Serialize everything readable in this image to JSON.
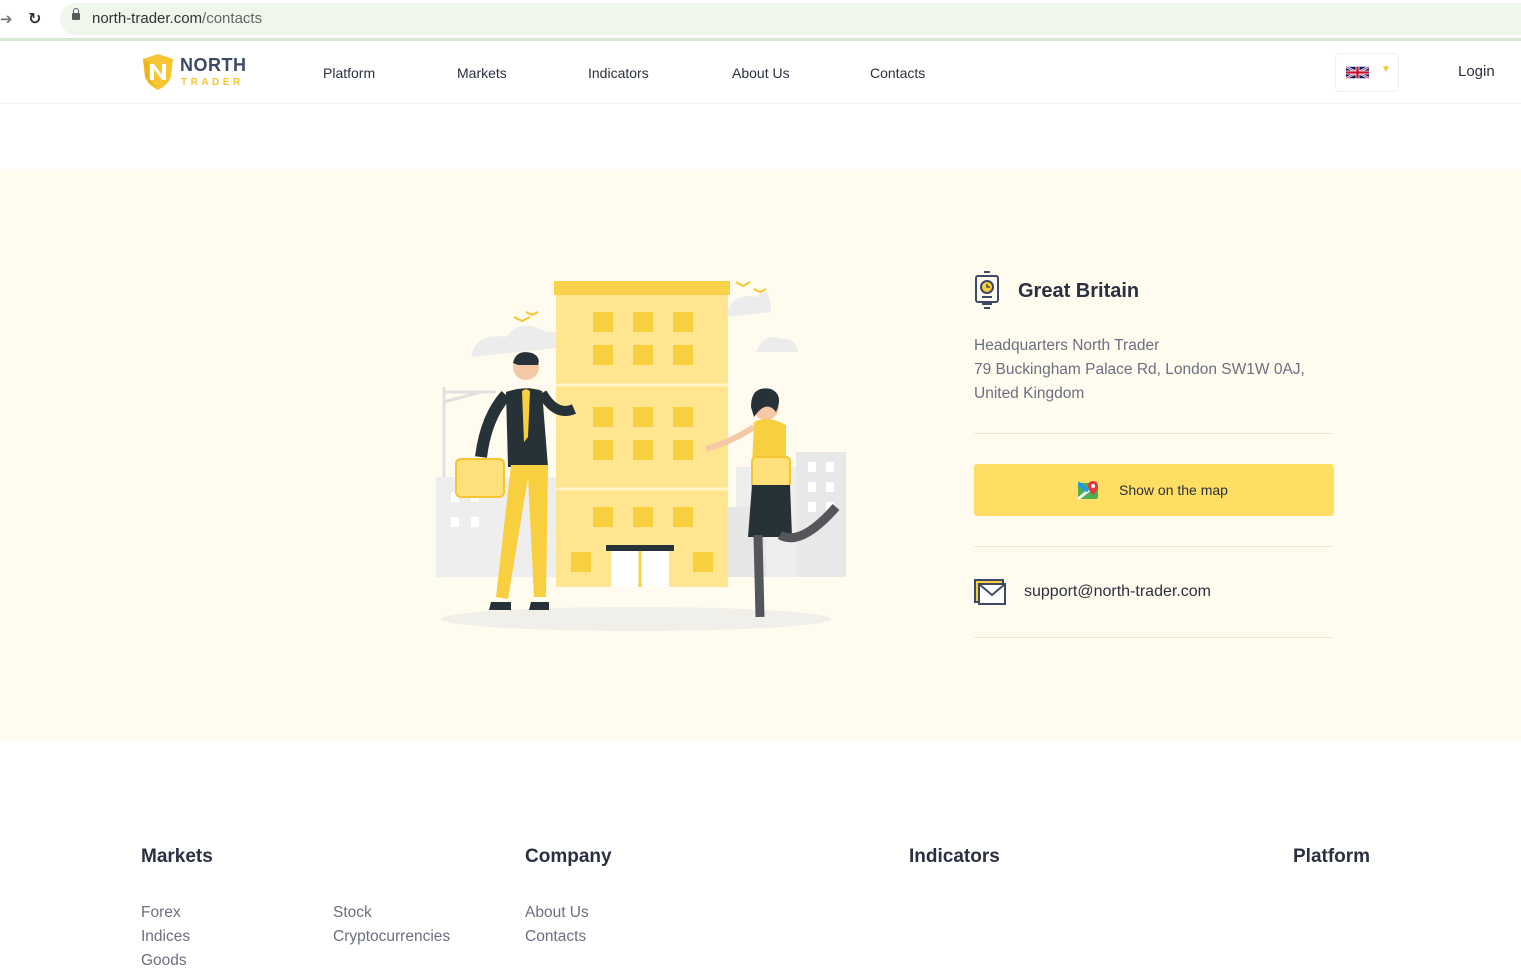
{
  "browser": {
    "url_domain": "north-trader.com",
    "url_path": "/contacts"
  },
  "header": {
    "logo_line1": "NORTH",
    "logo_line2": "TRADER",
    "nav": [
      "Platform",
      "Markets",
      "Indicators",
      "About Us",
      "Contacts"
    ],
    "language": "en-GB",
    "login": "Login"
  },
  "contact": {
    "country": "Great Britain",
    "address_lines": [
      "Headquarters North Trader",
      "79 Buckingham Palace Rd, London SW1W 0AJ,",
      "United Kingdom"
    ],
    "map_button": "Show on the map",
    "email": "support@north-trader.com"
  },
  "footer": {
    "headings": {
      "markets": "Markets",
      "company": "Company",
      "indicators": "Indicators",
      "platform": "Platform"
    },
    "markets_col1": [
      "Forex",
      "Indices",
      "Goods"
    ],
    "markets_col2": [
      "Stock",
      "Cryptocurrencies"
    ],
    "company_links": [
      "About Us",
      "Contacts"
    ]
  },
  "colors": {
    "accent_yellow": "#fedf63",
    "section_bg": "#fffbee",
    "text_dark": "#2b3040",
    "text_muted": "#6b7080"
  }
}
